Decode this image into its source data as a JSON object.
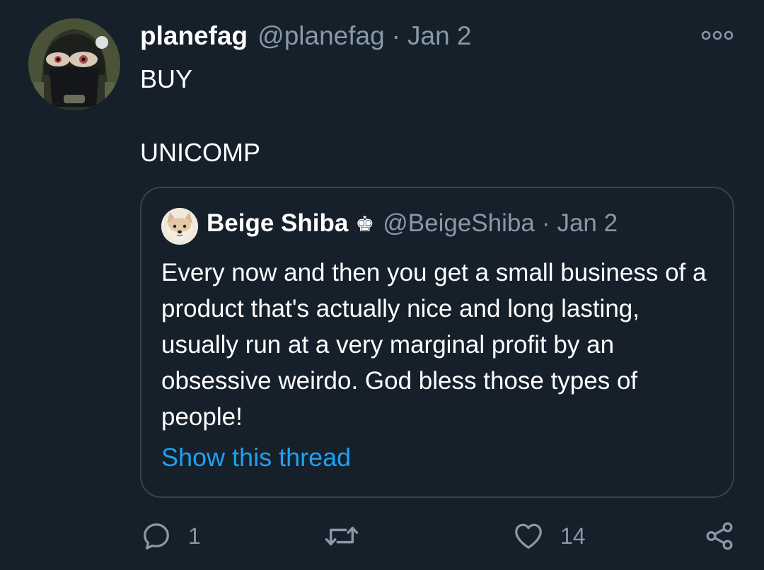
{
  "tweet": {
    "author_name": "planefag",
    "author_handle": "@planefag",
    "separator": "·",
    "date": "Jan 2",
    "text_lines": [
      "BUY",
      "",
      "UNICOMP"
    ],
    "more_icon": "more-options-icon"
  },
  "quote": {
    "author_name": "Beige Shiba",
    "badge": "♚",
    "author_handle": "@BeigeShiba",
    "separator": "·",
    "date": "Jan 2",
    "text": "Every now and then you get a small business of a product that's actually nice and long lasting, usually run at a very marginal profit by an obsessive weirdo. God bless those types of people!",
    "show_thread": "Show this thread"
  },
  "actions": {
    "reply_count": "1",
    "retweet_count": "",
    "like_count": "14",
    "share_count": ""
  },
  "colors": {
    "background": "#15202b",
    "text": "#ffffff",
    "muted": "#8899a6",
    "border": "#38444d",
    "link": "#1da1f2"
  }
}
